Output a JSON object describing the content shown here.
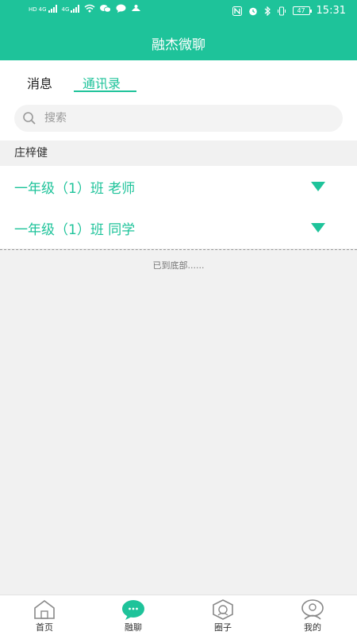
{
  "status_bar": {
    "time": "15:31",
    "battery": "47",
    "network_1": "4G",
    "network_2": "4G"
  },
  "app_title": "融杰微聊",
  "tabs": [
    {
      "label": "消息",
      "active": false
    },
    {
      "label": "通讯录",
      "active": true
    }
  ],
  "search": {
    "placeholder": "搜索"
  },
  "section_header": "庄梓健",
  "groups": [
    {
      "label": "一年级（1）班 老师"
    },
    {
      "label": "一年级（1）班 同学"
    }
  ],
  "list_end_text": "已到底部......",
  "bottom_nav": [
    {
      "label": "首页",
      "icon": "home-icon"
    },
    {
      "label": "融聊",
      "icon": "chat-bubble-icon",
      "active": true
    },
    {
      "label": "圈子",
      "icon": "circle-hexagon-icon"
    },
    {
      "label": "我的",
      "icon": "profile-icon"
    }
  ],
  "colors": {
    "accent": "#1ec39a",
    "background": "#f1f1f1"
  }
}
